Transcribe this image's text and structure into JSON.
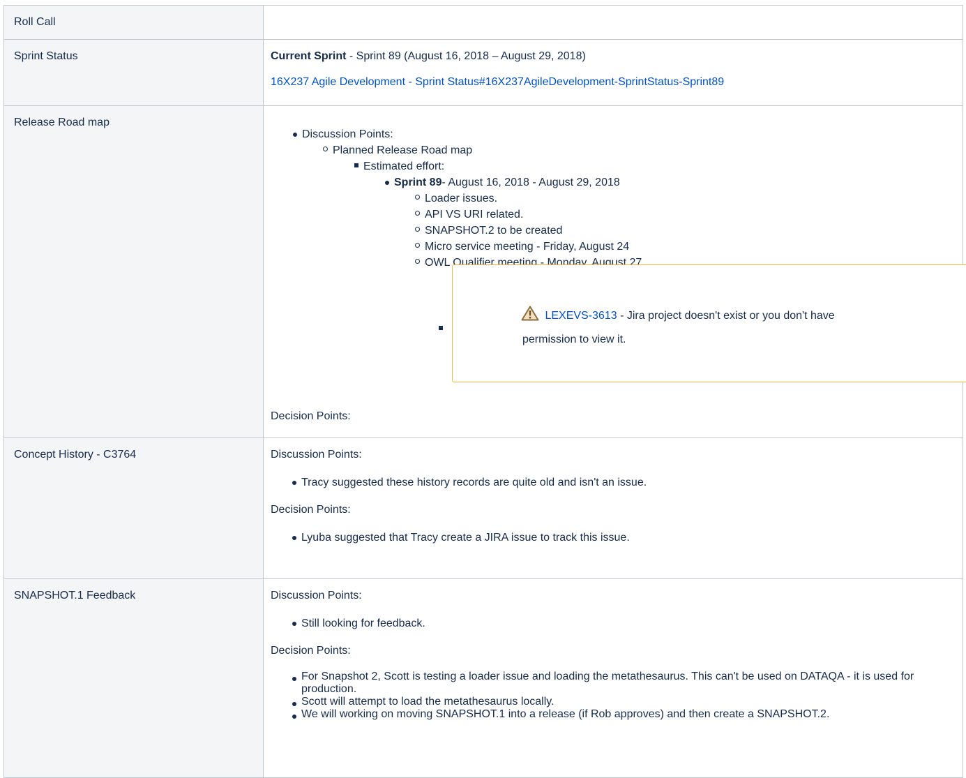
{
  "rows": {
    "roll_call": {
      "label": "Roll Call"
    },
    "sprint_status": {
      "label": "Sprint Status",
      "current_sprint_label": "Current Sprint",
      "current_sprint_text": " -  Sprint 89 (August 16, 2018 – August 29, 2018)",
      "link_text": "16X237 Agile Development - Sprint Status#16X237AgileDevelopment-SprintStatus-Sprint89"
    },
    "release_road_map": {
      "label": "Release Road map",
      "discussion_points": "Discussion Points:",
      "planned": "Planned Release Road map",
      "estimated_effort": "Estimated effort:",
      "sprint_label": "Sprint 89",
      "sprint_dates": "- August 16, 2018 - August 29, 2018",
      "items": [
        "Loader issues.",
        "API VS URI related.",
        "SNAPSHOT.2 to be created",
        "Micro service meeting - Friday, August 24",
        "OWL Qualifier meeting - Monday, August 27"
      ],
      "jira": {
        "key": "LEXEVS-3613",
        "message_part1": " - Jira project doesn't exist or you don't have",
        "message_part2": "permission to view it.",
        "icon": "warning-triangle-icon"
      },
      "decision_points": "Decision Points:"
    },
    "concept_history": {
      "label": "Concept History - C3764",
      "discussion_points": "Discussion Points:",
      "discussion_items": [
        "Tracy suggested these history records are quite old and isn't an issue."
      ],
      "decision_points": "Decision Points:",
      "decision_items": [
        "Lyuba suggested that Tracy create a JIRA issue to track this issue."
      ]
    },
    "snapshot_feedback": {
      "label": "SNAPSHOT.1 Feedback",
      "discussion_points": "Discussion Points:",
      "discussion_items": [
        "Still looking for feedback."
      ],
      "decision_points": "Decision Points:",
      "decision_items": [
        "For Snapshot 2, Scott is testing a loader issue and loading the metathesaurus. This can't be used on DATAQA - it is used for production.",
        "Scott will attempt to load the metathesaurus locally.",
        "We will working on moving SNAPSHOT.1 into a release (if Rob approves) and then create a SNAPSHOT.2."
      ]
    }
  },
  "colors": {
    "text": "#172b4d",
    "link": "#0052cc",
    "header_bg": "#f4f5f7",
    "border": "#c1c7d0",
    "warning_border": "#f6b73a"
  }
}
